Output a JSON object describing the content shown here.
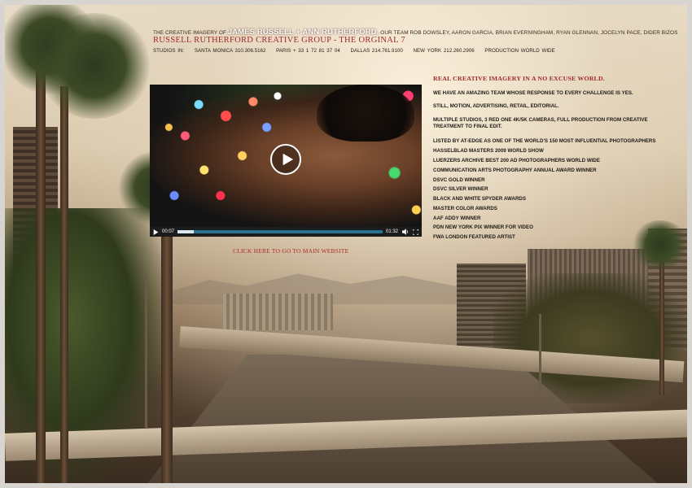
{
  "header": {
    "intro_prefix": "THE CREATIVE IMAGERY OF",
    "intro_names": "JAMES RUSSELL + ANN RUTHERFORD,",
    "intro_suffix": "OUR TEAM ROB DOWSLEY, AARON GARCIA, BRIAN EVERNINGHAM, RYAN GLENNAN, JOCELYN PACE, DIDER BIZOS",
    "group_title": "RUSSELL RUTHERFORD CREATIVE GROUP - THE ORGINAL 7",
    "studios": [
      "STUDIOS IN:",
      "SANTA MONICA  310.306.5162",
      "PARIS + 33 1 72 81 37 04",
      "DALLAS 214.761.9100",
      "NEW YORK  212.260.2906",
      "PRODUCTION WORLD WIDE"
    ]
  },
  "video": {
    "current_time": "00:07",
    "duration": "01:32",
    "progress": 0.08
  },
  "main_link": "CLICK HERE TO GO TO MAIN WEBSITE",
  "right": {
    "headline": "REAL CREATIVE IMAGERY IN A NO EXCUSE WORLD.",
    "paragraphs": [
      "WE HAVE AN AMAZING TEAM WHOSE RESPONSE TO EVERY CHALLENGE IS YES.",
      "STILL, MOTION, ADVERTISING, RETAIL, EDITORIAL.",
      "MULTIPLE STUDIOS, 3 RED ONE 4K/5K CAMERAS, FULL PRODUCTION FROM CREATIVE TREATMENT TO FINAL EDIT."
    ],
    "awards": [
      "LISTED BY AT-EDGE AS ONE OF THE WORLD'S 150 MOST INFLUENTIAL PHOTOGRAPHERS",
      "HASSELBLAD MASTERS 2009 WORLD SHOW",
      "LUERZERS ARCHIVE BEST 200 AD PHOTOGRAPHERS WORLD WIDE",
      "COMMUNICATION ARTS PHOTOGRAPHY ANNUAL AWARD WINNER",
      "DSVC GOLD WINNER",
      "DSVC SILVER WINNER",
      "BLACK AND WHITE SPYDER AWARDS",
      "MASTER COLOR AWARDS",
      "AAF ADDY WINNER",
      "PDN NEW YORK PIX WINNER FOR VIDEO",
      "FWA LONDON FEATURED ARTIST"
    ]
  }
}
